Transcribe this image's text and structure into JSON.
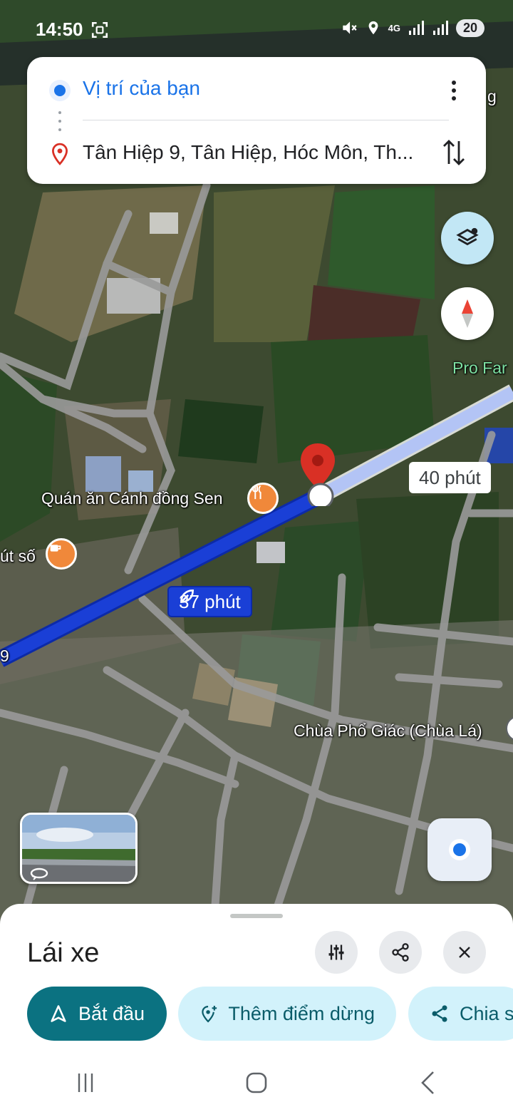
{
  "status_bar": {
    "time": "14:50",
    "battery": "20",
    "network": "4G"
  },
  "directions": {
    "origin": "Vị trí của bạn",
    "destination": "Tân Hiệp 9, Tân Hiệp, Hóc Môn, Th..."
  },
  "map": {
    "labels": {
      "restaurant": "Quán ăn Cánh đồng Sen",
      "cafe": "út số",
      "pagoda": "Chùa Phổ Giác (Chùa Lá)",
      "farm": "Pro Far",
      "top_right_fragment": "g",
      "road_fragment": "9"
    },
    "routes": {
      "selected_time": "37 phút",
      "alternate_time": "40 phút"
    }
  },
  "bottom_sheet": {
    "title": "Lái xe",
    "start_label": "Bắt đầu",
    "add_stop_label": "Thêm điểm dừng",
    "share_label": "Chia s"
  },
  "colors": {
    "route_selected": "#1a3fd6",
    "route_alt": "#b3c4f5",
    "accent_teal": "#0b7281",
    "pill_light": "#d2f2fb",
    "origin_blue": "#1a73e8",
    "pin_red": "#d93025"
  }
}
